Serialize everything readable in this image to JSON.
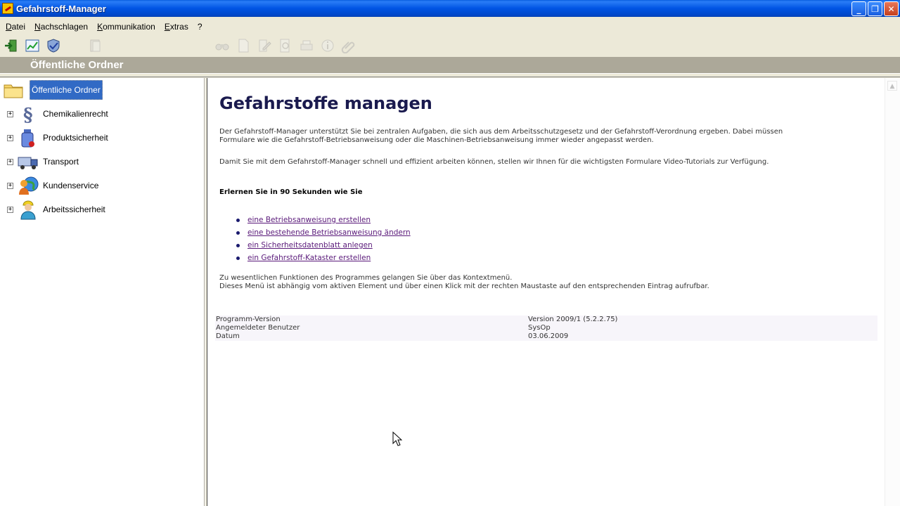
{
  "window": {
    "title": "Gefahrstoff-Manager",
    "controls": {
      "minimize": "_",
      "maximize": "❐",
      "close": "✕"
    }
  },
  "menu": [
    "Datei",
    "Nachschlagen",
    "Kommunikation",
    "Extras",
    "?"
  ],
  "toolbar": {
    "icons": [
      "exit-icon",
      "chart-icon",
      "shield-check-icon",
      "document-stack-icon",
      "binoculars-icon",
      "new-document-icon",
      "edit-document-icon",
      "preview-icon",
      "print-icon",
      "info-icon",
      "attachment-icon"
    ]
  },
  "header": {
    "title": "Öffentliche Ordner"
  },
  "tree": {
    "root": "Öffentliche Ordner",
    "nodes": [
      {
        "label": "Chemikalienrecht",
        "icon": "paragraph-icon"
      },
      {
        "label": "Produktsicherheit",
        "icon": "bottle-icon"
      },
      {
        "label": "Transport",
        "icon": "truck-icon"
      },
      {
        "label": "Kundenservice",
        "icon": "person-globe-icon"
      },
      {
        "label": "Arbeitssicherheit",
        "icon": "worker-icon"
      }
    ],
    "expander_symbol": "+"
  },
  "content": {
    "title": "Gefahrstoffe managen",
    "p1": "Der Gefahrstoff-Manager unterstützt Sie bei zentralen Aufgaben, die sich aus dem Arbeitsschutzgesetz und der Gefahrstoff-Verordnung ergeben. Dabei müssen Formulare wie die Gefahrstoff-Betriebsanweisung oder die Maschinen-Betriebsanweisung immer wieder angepasst werden.",
    "p2": "Damit Sie mit dem Gefahrstoff-Manager schnell und effizient arbeiten können, stellen wir Ihnen für die wichtigsten Formulare Video-Tutorials zur Verfügung.",
    "learn_heading": "Erlernen Sie in 90 Sekunden wie Sie",
    "links": [
      "eine Betriebsanweisung erstellen",
      "eine bestehende Betriebsanweisung ändern",
      "ein Sicherheitsdatenblatt anlegen",
      "ein Gefahrstoff-Kataster erstellen"
    ],
    "p3": "Zu wesentlichen Funktionen des Programmes gelangen Sie über das Kontextmenü.",
    "p4": "Dieses Menü ist abhängig vom aktiven Element und über einen Klick mit der rechten Maustaste auf den entsprechenden Eintrag aufrufbar.",
    "info": [
      {
        "key": "Programm-Version",
        "value": "Version 2009/1 (5.2.2.75)"
      },
      {
        "key": "Angemeldeter Benutzer",
        "value": "SysOp"
      },
      {
        "key": "Datum",
        "value": "03.06.2009"
      }
    ],
    "scroll_up": "▲"
  },
  "colors": {
    "titlebar": "#0054e3",
    "selection": "#316ac5",
    "header_band": "#aca899",
    "page_title": "#1a1a4e",
    "link": "#5a1a7a"
  }
}
